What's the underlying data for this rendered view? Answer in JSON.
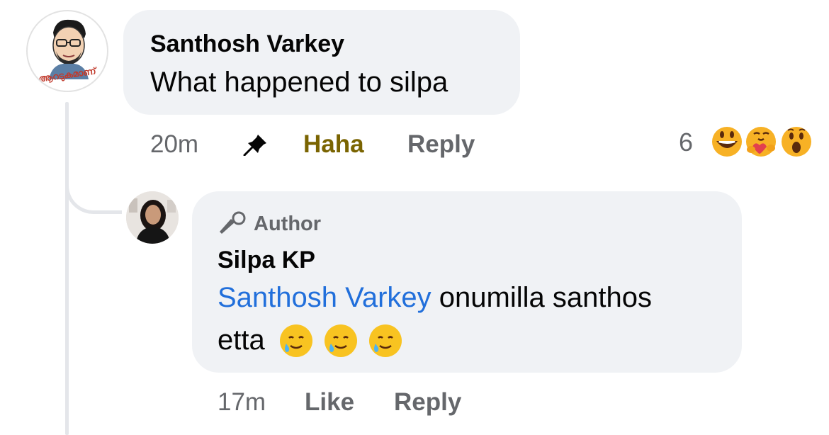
{
  "comment": {
    "author": "Santhosh Varkey",
    "avatar_caption": "ആറടുകമാണ്",
    "text": "What happened to silpa",
    "time": "20m",
    "reaction_label": "Haha",
    "reply_label": "Reply",
    "reaction_count": "6",
    "reaction_icons": [
      "grinning-face-icon",
      "hugging-face-icon",
      "astonished-face-icon"
    ]
  },
  "reply": {
    "badge": "Author",
    "author": "Silpa KP",
    "mention": "Santhosh Varkey",
    "text_line1": " onumilla santhos",
    "text_line2": "etta",
    "emojis": [
      "smiling-face-with-tear-icon",
      "smiling-face-with-tear-icon",
      "smiling-face-with-tear-icon"
    ],
    "time": "17m",
    "like_label": "Like",
    "reply_label": "Reply"
  }
}
